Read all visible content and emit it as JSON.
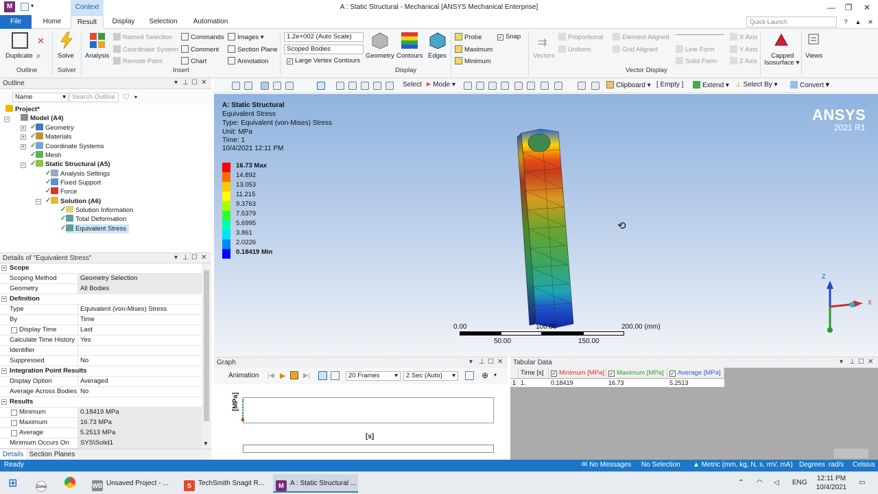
{
  "window": {
    "title": "A : Static Structural - Mechanical [ANSYS Mechanical Enterprise]",
    "context_tab": "Context",
    "app_letter": "M"
  },
  "tabs": [
    "File",
    "Home",
    "Result",
    "Display",
    "Selection",
    "Automation"
  ],
  "active_tab": "Result",
  "quick_launch_placeholder": "Quick Launch",
  "ribbon": {
    "duplicate": "Duplicate",
    "outline_group": "Outline",
    "solve": "Solve",
    "solver_group": "Solver",
    "analysis": "Analysis",
    "named_selection": "Named Selection",
    "coordinate_system": "Coordinate System",
    "remote_point": "Remote Point",
    "commands": "Commands",
    "comment": "Comment",
    "chart": "Chart",
    "images": "Images",
    "section_plane": "Section Plane",
    "annotation": "Annotation",
    "insert_group": "Insert",
    "scale_value": "1.2e+002 (Auto Scale)",
    "scoped_bodies": "Scoped Bodies",
    "large_vertex": "Large Vertex Contours",
    "geometry": "Geometry",
    "contours": "Contours",
    "edges": "Edges",
    "display_group": "Display",
    "probe": "Probe",
    "maximum": "Maximum",
    "minimum": "Minimum",
    "snap": "Snap",
    "vectors": "Vectors",
    "proportional": "Proportional",
    "uniform": "Uniform",
    "element_aligned": "Element Aligned",
    "grid_aligned": "Grid Aligned",
    "line_form": "Line Form",
    "solid_form": "Solid Form",
    "x_axis": "X Axis",
    "y_axis": "Y Axis",
    "z_axis": "Z Axis",
    "vector_display_group": "Vector Display",
    "capped_isosurface_1": "Capped",
    "capped_isosurface_2": "Isosurface",
    "views": "Views"
  },
  "toolbar": {
    "select": "Select",
    "mode": "Mode",
    "clipboard": "Clipboard",
    "empty": "[ Empty ]",
    "extend": "Extend",
    "select_by": "Select By",
    "convert": "Convert"
  },
  "outline": {
    "title": "Outline",
    "filter_value": "Name",
    "search_placeholder": "Search Outline",
    "nodes": [
      {
        "label": "Project*",
        "bold": true
      },
      {
        "label": "Model (A4)",
        "bold": true
      },
      {
        "label": "Geometry",
        "bold": false
      },
      {
        "label": "Materials",
        "bold": false
      },
      {
        "label": "Coordinate Systems",
        "bold": false
      },
      {
        "label": "Mesh",
        "bold": false
      },
      {
        "label": "Static Structural (A5)",
        "bold": true
      },
      {
        "label": "Analysis Settings",
        "bold": false
      },
      {
        "label": "Fixed Support",
        "bold": false
      },
      {
        "label": "Force",
        "bold": false
      },
      {
        "label": "Solution (A6)",
        "bold": true
      },
      {
        "label": "Solution Information",
        "bold": false
      },
      {
        "label": "Total Deformation",
        "bold": false
      },
      {
        "label": "Equivalent Stress",
        "bold": false
      }
    ]
  },
  "details": {
    "title": "Details of \"Equivalent Stress\"",
    "sections": {
      "scope": "Scope",
      "definition": "Definition",
      "integration": "Integration Point Results",
      "results": "Results"
    },
    "rows": {
      "scoping_method": [
        "Scoping Method",
        "Geometry Selection"
      ],
      "geometry": [
        "Geometry",
        "All Bodies"
      ],
      "type": [
        "Type",
        "Equivalent (von-Mises) Stress"
      ],
      "by": [
        "By",
        "Time"
      ],
      "display_time": [
        "Display Time",
        "Last"
      ],
      "calc_time_history": [
        "Calculate Time History",
        "Yes"
      ],
      "identifier": [
        "Identifier",
        ""
      ],
      "suppressed": [
        "Suppressed",
        "No"
      ],
      "display_option": [
        "Display Option",
        "Averaged"
      ],
      "average_across": [
        "Average Across Bodies",
        "No"
      ],
      "minimum": [
        "Minimum",
        "0.18419 MPa"
      ],
      "maximum": [
        "Maximum",
        "16.73 MPa"
      ],
      "average": [
        "Average",
        "5.2513 MPa"
      ],
      "min_occurs": [
        "Minimum Occurs On",
        "SYS\\Solid1"
      ]
    },
    "bottom_tabs": [
      "Details",
      "Section Planes"
    ]
  },
  "viewport": {
    "info": [
      "A: Static Structural",
      "Equivalent Stress",
      "Type: Equivalent (von-Mises) Stress",
      "Unit: MPa",
      "Time: 1",
      "10/4/2021 12:11 PM"
    ],
    "logo_main": "ANSYS",
    "logo_version": "2021 R1",
    "legend": {
      "labels": [
        "16.73 Max",
        "14.892",
        "13.053",
        "11.215",
        "9.3763",
        "7.5379",
        "5.6995",
        "3.861",
        "2.0226",
        "0.18419 Min"
      ],
      "colors": [
        "#ff0000",
        "#ff6a00",
        "#ffc800",
        "#ffff00",
        "#a8ff00",
        "#30ff30",
        "#00ffaa",
        "#00e0ff",
        "#0088ff",
        "#0000ff"
      ]
    },
    "scale": {
      "top": [
        "0.00",
        "100.00",
        "200.00 (mm)"
      ],
      "bottom": [
        "50.00",
        "150.00"
      ]
    },
    "triad": {
      "z": "Z",
      "x": "X"
    }
  },
  "graph": {
    "title": "Graph",
    "animation": "Animation",
    "frames": "20 Frames",
    "duration": "2 Sec (Auto)",
    "ylabel": "[MPa]",
    "xlabel": "[s]"
  },
  "tabular": {
    "title": "Tabular Data",
    "headers": [
      "Time [s]",
      "Minimum [MPa]",
      "Maximum [MPa]",
      "Average [MPa]"
    ],
    "header_colors": [
      "#222222",
      "#d8312b",
      "#2f9a2f",
      "#2c5ccf"
    ],
    "row_index": "1",
    "row": [
      "1.",
      "0.18419",
      "16.73",
      "5.2513"
    ]
  },
  "status": {
    "ready": "Ready",
    "messages": "No Messages",
    "selection": "No Selection",
    "units": "Metric (mm, kg, N, s, mV, mA)",
    "degrees": "Degrees",
    "rads": "rad/s",
    "celsius": "Celsius"
  },
  "taskbar": {
    "items": [
      "Unsaved Project - ...",
      "TechSmith Snagit R...",
      "A : Static Structural ..."
    ],
    "lang": "ENG",
    "time": "12:11 PM",
    "date": "10/4/2021"
  }
}
